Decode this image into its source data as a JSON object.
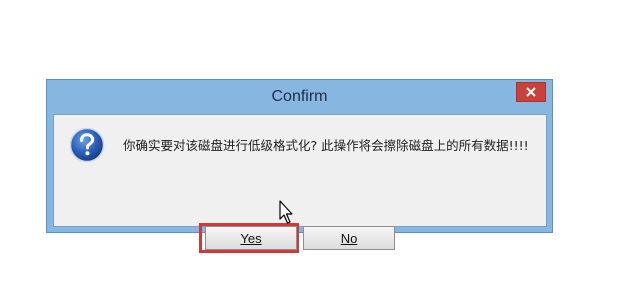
{
  "dialog": {
    "title": "Confirm",
    "close_icon": "close-icon",
    "icon": "question-icon",
    "message": "你确实要对该磁盘进行低级格式化? 此操作将会擦除磁盘上的所有数据!!!!",
    "buttons": {
      "yes_label": "Yes",
      "no_label": "No"
    }
  },
  "colors": {
    "frame": "#87b7e0",
    "close_button": "#c8413b",
    "highlight": "#d0383a",
    "client_bg": "#f0f0f0"
  }
}
